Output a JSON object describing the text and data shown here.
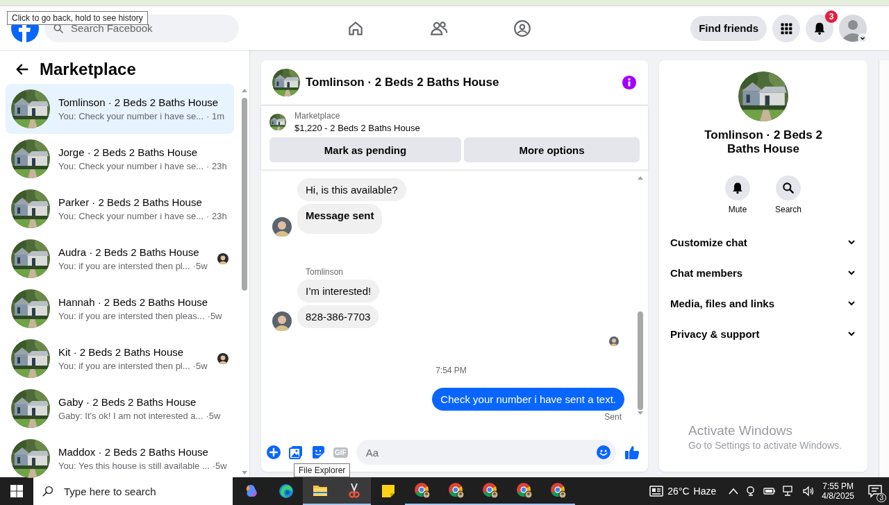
{
  "browser": {
    "tooltip": "Click to go back, hold to see history"
  },
  "header": {
    "search_placeholder": "Search Facebook",
    "nav": [
      {
        "kind": "home"
      },
      {
        "kind": "friends"
      },
      {
        "kind": "groups"
      }
    ],
    "find_friends": "Find friends",
    "notification_count": "3"
  },
  "sidebar": {
    "title": "Marketplace",
    "conversations": [
      {
        "name": "Tomlinson · 2 Beds 2 Baths House",
        "preview": "You: Check your number i have se...",
        "time": "· 1m",
        "selected": true,
        "read_receipt": false
      },
      {
        "name": "Jorge · 2 Beds 2 Baths House",
        "preview": "You: Check your number i have se...",
        "time": "· 23h",
        "selected": false,
        "read_receipt": false
      },
      {
        "name": "Parker · 2 Beds 2 Baths House",
        "preview": "You: Check your number i have se...",
        "time": "· 23h",
        "selected": false,
        "read_receipt": false
      },
      {
        "name": "Audra · 2 Beds 2 Baths House",
        "preview": "You: if you are intersted then pl...",
        "time": "·5w",
        "selected": false,
        "read_receipt": true
      },
      {
        "name": "Hannah · 2 Beds 2 Baths House",
        "preview": "You: if you are intersted then pleas...",
        "time": "·5w",
        "selected": false,
        "read_receipt": false
      },
      {
        "name": "Kit · 2 Beds 2 Baths House",
        "preview": "You: if you are intersted then pl...",
        "time": "·5w",
        "selected": false,
        "read_receipt": true
      },
      {
        "name": "Gaby · 2 Beds 2 Baths House",
        "preview": "Gaby: It's ok! I am not interested a...",
        "time": "·5w",
        "selected": false,
        "read_receipt": false
      },
      {
        "name": "Maddox · 2 Beds 2 Baths House",
        "preview": "You: Yes this house is still available ...",
        "time": "·5w",
        "selected": false,
        "read_receipt": false
      }
    ]
  },
  "chat": {
    "title": "Tomlinson · 2 Beds 2 Baths House",
    "listing": {
      "label": "Marketplace",
      "price": "$1,220 - 2 Beds 2 Baths House"
    },
    "buttons": [
      "Mark as pending",
      "More options"
    ],
    "messages": [
      {
        "kind": "incoming",
        "text": "Hi, is this available?",
        "avatar": false
      },
      {
        "kind": "notice",
        "text": "Message sent",
        "avatar": true
      },
      {
        "kind": "sender",
        "text": "Tomlinson"
      },
      {
        "kind": "incoming",
        "text": "I’m interested!",
        "avatar": false
      },
      {
        "kind": "incoming",
        "text": "828-386-7703",
        "avatar": true
      },
      {
        "kind": "seen"
      },
      {
        "kind": "time",
        "text": "7:54 PM"
      },
      {
        "kind": "outgoing",
        "text": "Check your number i have sent a text."
      },
      {
        "kind": "status",
        "text": "Sent"
      }
    ],
    "composer": {
      "placeholder": "Aa",
      "gif_label": "GIF"
    }
  },
  "details": {
    "title": "Tomlinson · 2 Beds 2 Baths House",
    "actions": [
      {
        "kind": "bell",
        "label": "Mute"
      },
      {
        "kind": "search",
        "label": "Search"
      }
    ],
    "sections": [
      {
        "label": "Customize chat",
        "expanded": false
      },
      {
        "label": "Chat members",
        "expanded": false
      },
      {
        "label": "Media, files and links",
        "expanded": false
      },
      {
        "label": "Privacy & support",
        "expanded": false
      }
    ]
  },
  "activation_notice": {
    "title": "Activate Windows",
    "subtitle": "Go to Settings to activate Windows."
  },
  "taskbar": {
    "search_placeholder": "Type here to search",
    "tooltip": "File Explorer",
    "apps": [
      {
        "kind": "copilot",
        "running": false,
        "highlighted": false
      },
      {
        "kind": "edge",
        "running": false,
        "highlighted": false
      },
      {
        "kind": "folder",
        "running": true,
        "highlighted": true
      },
      {
        "kind": "snip",
        "running": true,
        "highlighted": true
      },
      {
        "kind": "notes",
        "running": false,
        "highlighted": false
      },
      {
        "kind": "chrome",
        "running": true,
        "highlighted": false
      },
      {
        "kind": "chrome",
        "running": true,
        "highlighted": false
      },
      {
        "kind": "chrome",
        "running": true,
        "highlighted": false
      },
      {
        "kind": "chrome",
        "running": true,
        "highlighted": false
      },
      {
        "kind": "chrome",
        "running": true,
        "highlighted": false
      }
    ],
    "weather": {
      "temperature": "26°C",
      "condition": "Haze"
    },
    "time": "7:55 PM",
    "date": "4/8/2025",
    "notification_count": "3"
  }
}
